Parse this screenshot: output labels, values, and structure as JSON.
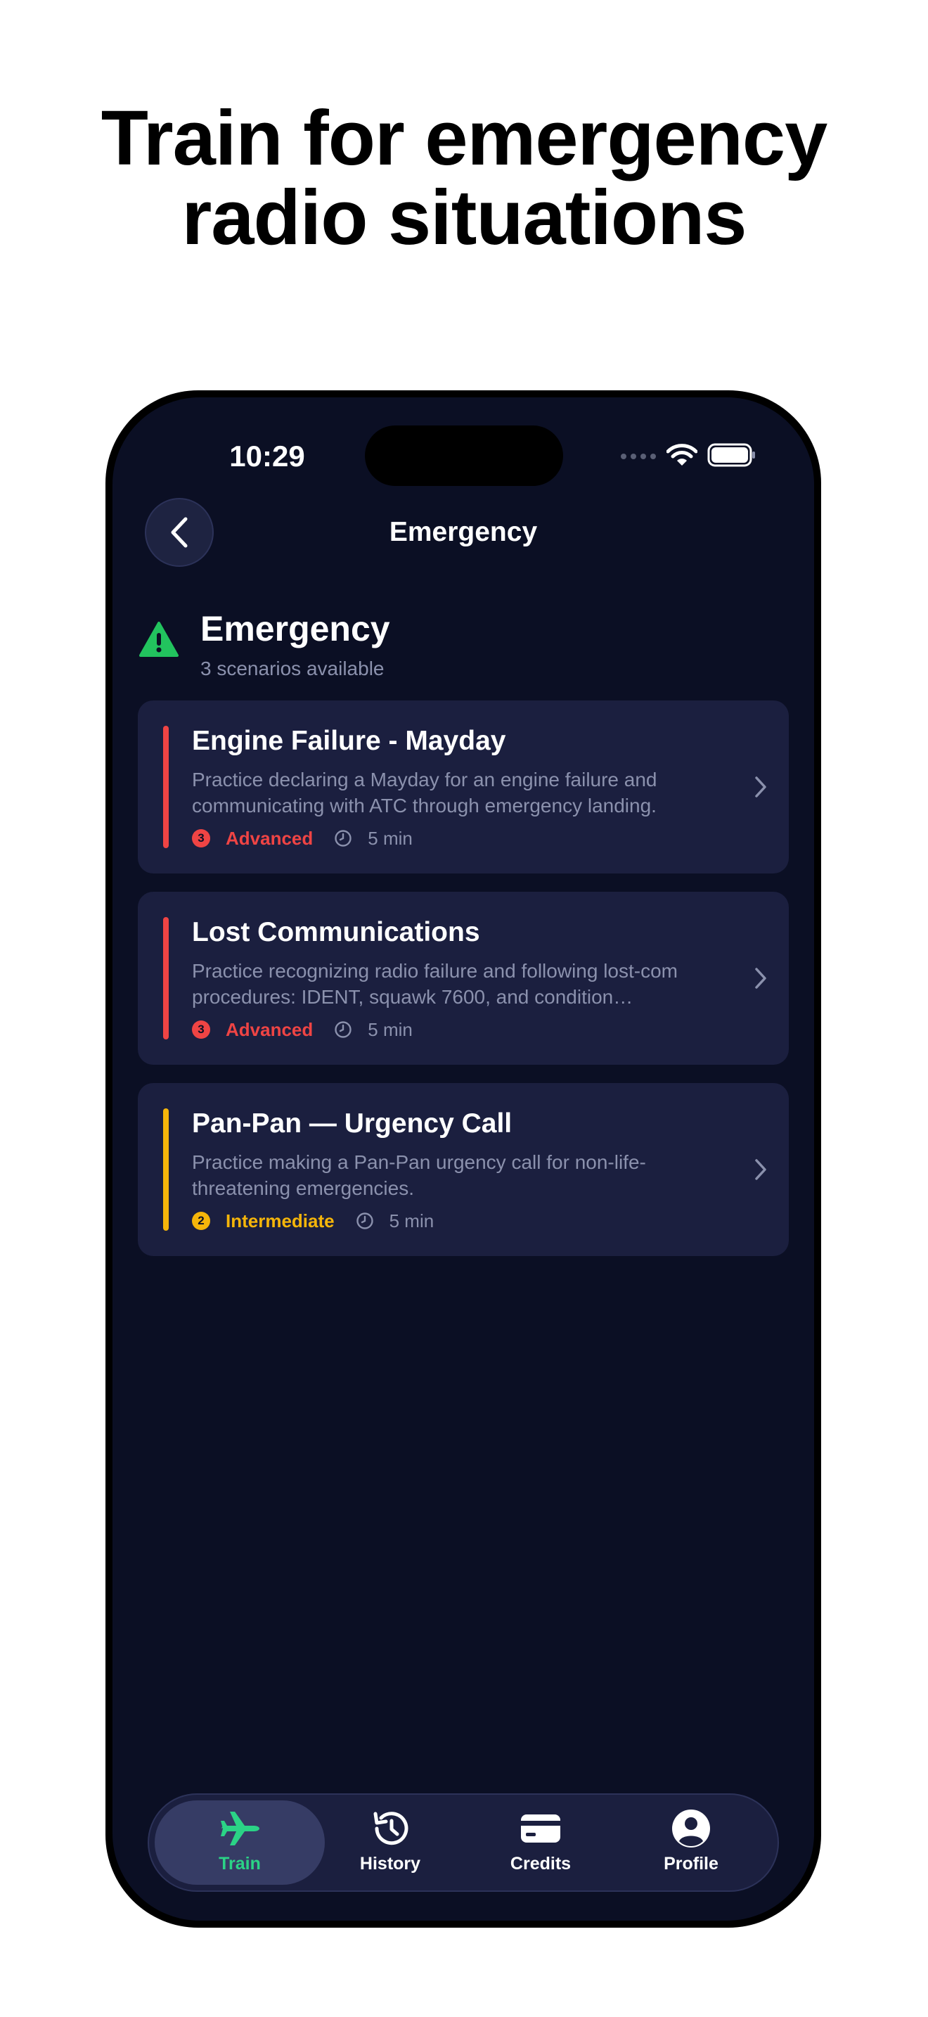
{
  "headline": {
    "line1": "Train for emergency",
    "line2": "radio situations"
  },
  "status_bar": {
    "time": "10:29"
  },
  "nav": {
    "title": "Emergency"
  },
  "section": {
    "title": "Emergency",
    "subtitle": "3 scenarios available",
    "icon": "warning-triangle-icon"
  },
  "scenarios": [
    {
      "title": "Engine Failure - Mayday",
      "description": "Practice declaring a Mayday for an engine failure and communicating with ATC through emergency landing.",
      "level_number": "3",
      "level": "Advanced",
      "duration": "5 min",
      "color": "#ef4444"
    },
    {
      "title": "Lost Communications",
      "description": "Practice recognizing radio failure and following lost-com procedures: IDENT, squawk 7600, and condition…",
      "level_number": "3",
      "level": "Advanced",
      "duration": "5 min",
      "color": "#ef4444"
    },
    {
      "title": "Pan-Pan — Urgency Call",
      "description": "Practice making a Pan-Pan urgency call for non-life-threatening emergencies.",
      "level_number": "2",
      "level": "Intermediate",
      "duration": "5 min",
      "color": "#f5b50a"
    }
  ],
  "tabs": [
    {
      "label": "Train",
      "icon": "airplane-icon",
      "active": true
    },
    {
      "label": "History",
      "icon": "history-icon",
      "active": false
    },
    {
      "label": "Credits",
      "icon": "credit-card-icon",
      "active": false
    },
    {
      "label": "Profile",
      "icon": "profile-icon",
      "active": false
    }
  ],
  "colors": {
    "background": "#0b0f24",
    "card": "#1b1f3f",
    "accent_green": "#2bd386",
    "advanced_red": "#ef4444",
    "intermediate_amber": "#f5b50a"
  }
}
